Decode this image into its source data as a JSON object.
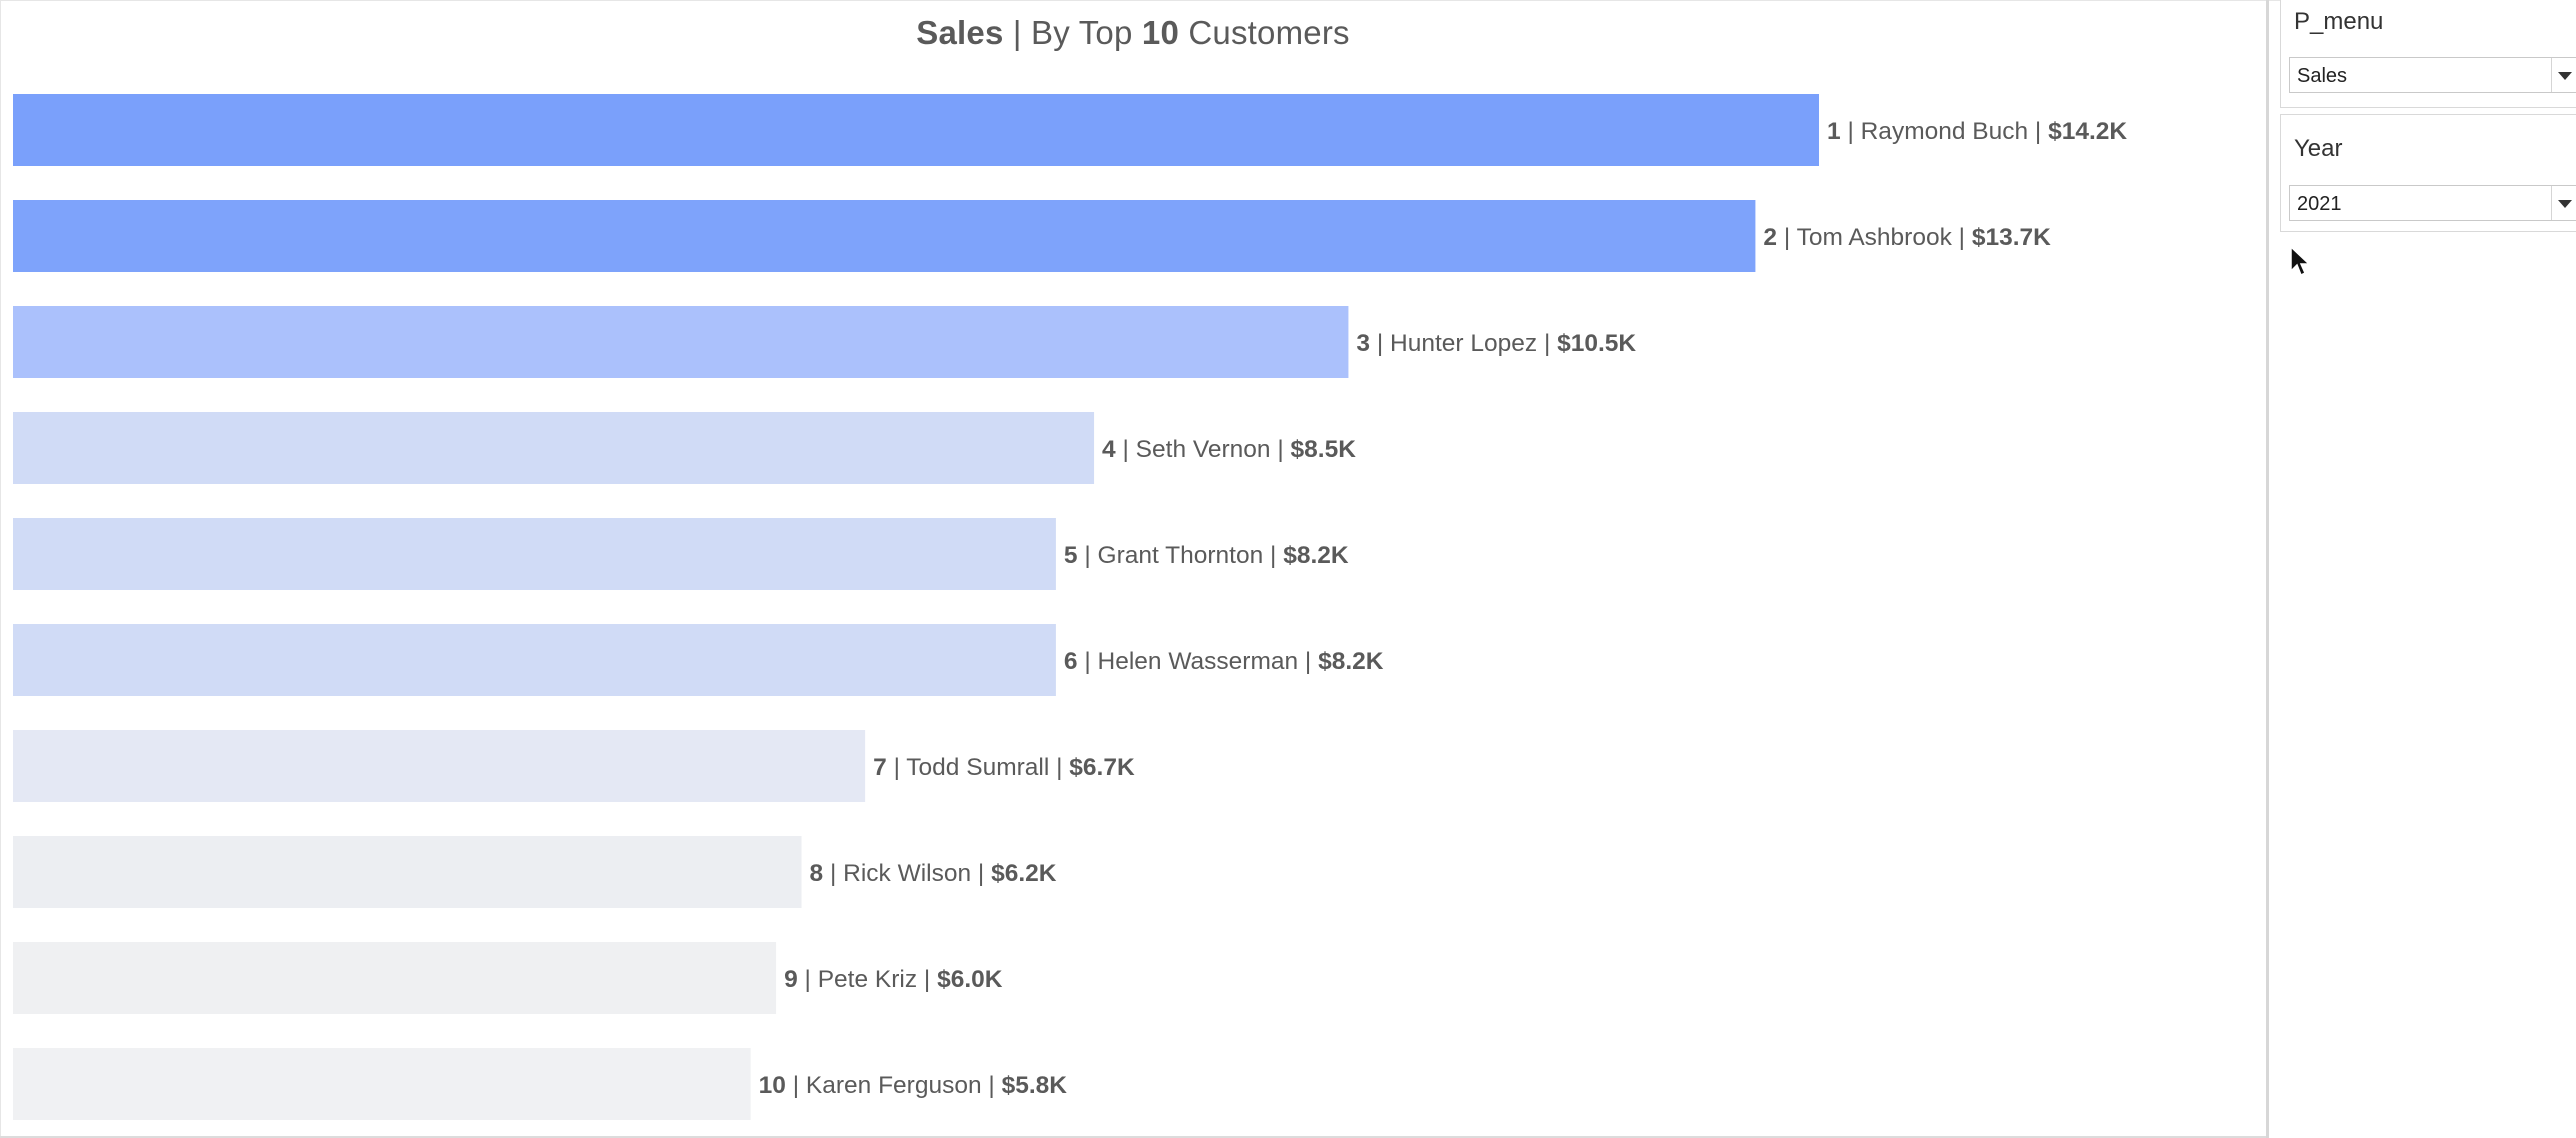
{
  "title": {
    "bold": "Sales",
    "sep": " | ",
    "pre": "By Top ",
    "num": "10",
    "post": " Customers"
  },
  "controls": {
    "p_menu": {
      "label": "P_menu",
      "value": "Sales"
    },
    "year": {
      "label": "Year",
      "value": "2021"
    }
  },
  "chart_data": {
    "type": "bar",
    "orientation": "horizontal",
    "categories": [
      "Raymond Buch",
      "Tom Ashbrook",
      "Hunter Lopez",
      "Seth Vernon",
      "Grant Thornton",
      "Helen Wasserman",
      "Todd Sumrall",
      "Rick Wilson",
      "Pete Kriz",
      "Karen Ferguson"
    ],
    "ranks": [
      "1",
      "2",
      "3",
      "4",
      "5",
      "6",
      "7",
      "8",
      "9",
      "10"
    ],
    "values": [
      14.2,
      13.7,
      10.5,
      8.5,
      8.2,
      8.2,
      6.7,
      6.2,
      6.0,
      5.8
    ],
    "value_labels": [
      "$14.2K",
      "$13.7K",
      "$10.5K",
      "$8.5K",
      "$8.2K",
      "$8.2K",
      "$6.7K",
      "$6.2K",
      "$6.0K",
      "$5.8K"
    ],
    "value_unit": "$K",
    "colors": [
      "#7aa0fb",
      "#7ea3fb",
      "#abc1fc",
      "#d0dbf6",
      "#d0dbf6",
      "#d0dbf6",
      "#e4e8f4",
      "#eceef2",
      "#eff0f2",
      "#f0f1f3"
    ],
    "grid": false,
    "legend": "none"
  }
}
